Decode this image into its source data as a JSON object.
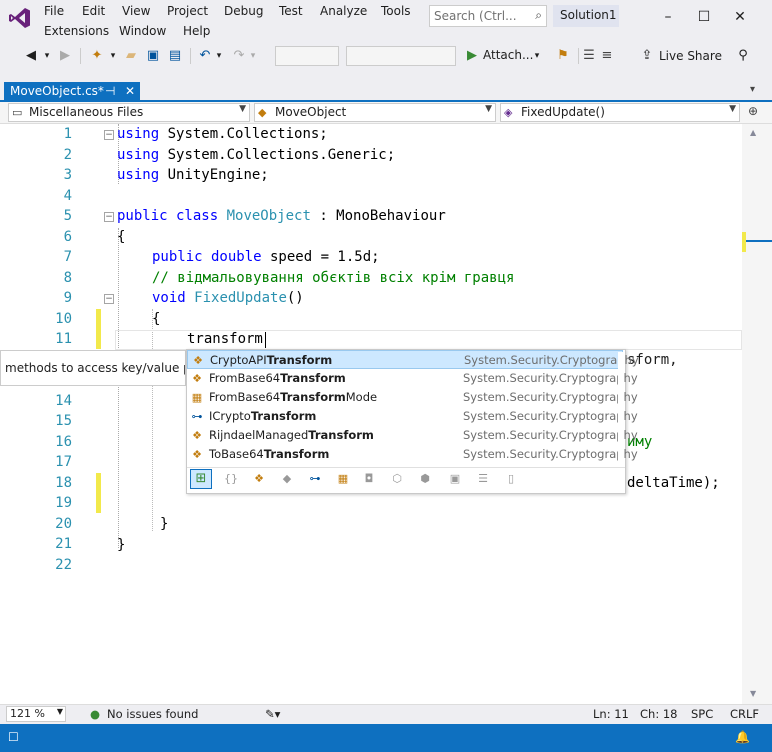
{
  "menu": {
    "file": "File",
    "edit": "Edit",
    "view": "View",
    "project": "Project",
    "debug": "Debug",
    "test": "Test",
    "analyze": "Analyze",
    "tools": "Tools",
    "extensions": "Extensions",
    "window": "Window",
    "help": "Help"
  },
  "search": {
    "placeholder": "Search (Ctrl..."
  },
  "solution": "Solution1",
  "toolbar": {
    "attach": "Attach...",
    "live_share": "Live Share"
  },
  "tab": {
    "title": "MoveObject.cs*",
    "pin": "⊣",
    "close": "✕"
  },
  "navbar": {
    "project": "Miscellaneous Files",
    "class": "MoveObject",
    "member": "FixedUpdate()"
  },
  "code": {
    "line_numbers": [
      "1",
      "2",
      "3",
      "4",
      "5",
      "6",
      "7",
      "8",
      "9",
      "10",
      "11",
      "12",
      "13",
      "14",
      "15",
      "16",
      "17",
      "18",
      "19",
      "20",
      "21",
      "22"
    ],
    "l1_kw": "using",
    "l1_rest": " System.Collections;",
    "l2_kw": "using",
    "l2_rest": " System.Collections.Generic;",
    "l3_kw": "using",
    "l3_rest": " UnityEngine;",
    "l5_kw": "public class",
    "l5_type": "MoveObject",
    "l5_rest": " : MonoBehaviour",
    "l6": "{",
    "l7_kw": "public double",
    "l7_rest": " speed = 1.5d;",
    "l8_comment": "// відмальовування обєктів всіх крім гравця",
    "l9_kw": "void",
    "l9_type": "FixedUpdate",
    "l9_rest": "()",
    "l10": "{",
    "l11": "transform",
    "l12_tail": "sform,",
    "l16_tail": "иму",
    "l18_tail": "deltaTime);",
    "l20": "}",
    "l21": "}"
  },
  "tooltip": "methods to access key/value pairs.",
  "completion": {
    "items": [
      {
        "pre": "CryptoAPI",
        "bold": "Transform",
        "post": "",
        "ns": "System.Security.Cryptography",
        "icon": "class-icon"
      },
      {
        "pre": "FromBase64",
        "bold": "Transform",
        "post": "",
        "ns": "System.Security.Cryptography",
        "icon": "class-icon"
      },
      {
        "pre": "FromBase64",
        "bold": "Transform",
        "post": "Mode",
        "ns": "System.Security.Cryptography",
        "icon": "enum-icon"
      },
      {
        "pre": "ICrypto",
        "bold": "Transform",
        "post": "",
        "ns": "System.Security.Cryptography",
        "icon": "interface-icon"
      },
      {
        "pre": "RijndaelManaged",
        "bold": "Transform",
        "post": "",
        "ns": "System.Security.Cryptography",
        "icon": "class-icon"
      },
      {
        "pre": "ToBase64",
        "bold": "Transform",
        "post": "",
        "ns": "System.Security.Cryptography",
        "icon": "class-icon"
      }
    ]
  },
  "status": {
    "zoom": "121 %",
    "issues": "No issues found",
    "line": "Ln: 11",
    "col": "Ch: 18",
    "spc": "SPC",
    "crlf": "CRLF"
  },
  "colors": {
    "accent": "#0e70c0",
    "keyword": "#0000ff",
    "type": "#2b91af",
    "comment": "#008000"
  }
}
